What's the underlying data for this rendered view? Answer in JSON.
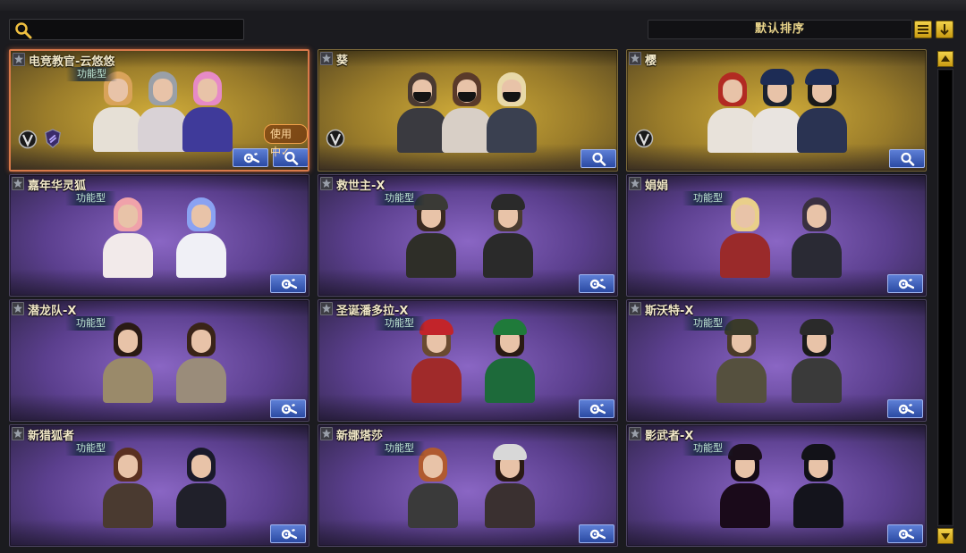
{
  "toolbar": {
    "search_placeholder": "",
    "sort_label": "默认排序"
  },
  "cards": [
    {
      "name": "电竞教官-云悠悠",
      "type": "功能型",
      "variant": "gold",
      "selected": true,
      "status": "使用中✓"
    },
    {
      "name": "葵",
      "type": "",
      "variant": "gold"
    },
    {
      "name": "樱",
      "type": "",
      "variant": "gold"
    },
    {
      "name": "嘉年华灵狐",
      "type": "功能型",
      "variant": "purple"
    },
    {
      "name": "救世主-X",
      "type": "功能型",
      "variant": "purple"
    },
    {
      "name": "娟娟",
      "type": "功能型",
      "variant": "purple"
    },
    {
      "name": "潜龙队-X",
      "type": "功能型",
      "variant": "purple"
    },
    {
      "name": "圣诞潘多拉-X",
      "type": "功能型",
      "variant": "purple"
    },
    {
      "name": "斯沃特-X",
      "type": "功能型",
      "variant": "purple"
    },
    {
      "name": "新猎狐者",
      "type": "功能型",
      "variant": "purple"
    },
    {
      "name": "新娜塔莎",
      "type": "功能型",
      "variant": "purple"
    },
    {
      "name": "影武者-X",
      "type": "功能型",
      "variant": "purple"
    }
  ],
  "icons": {
    "search": "search-icon",
    "list": "list-icon",
    "sort_direction": "arrow-down-icon",
    "settings": "wrench-gear-icon",
    "preview": "magnifier-icon",
    "favorite": "star-icon"
  },
  "colors": {
    "gold_card": "#b8962f",
    "purple_card": "#6a4aa6",
    "button_blue": "#3b5bb8",
    "selected_border": "#d9794a",
    "accent_yellow": "#e2b92a"
  }
}
